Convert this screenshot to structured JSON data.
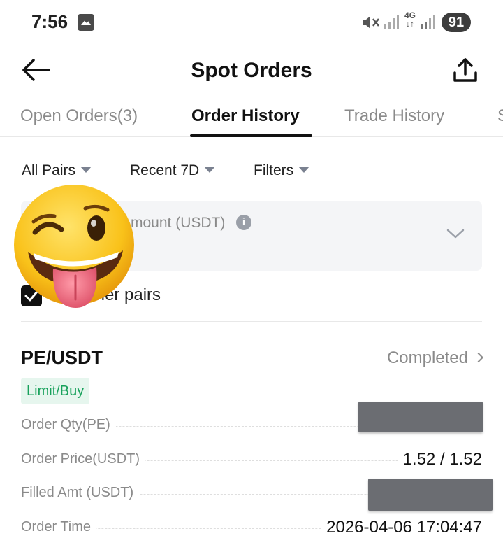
{
  "status_bar": {
    "time": "7:56",
    "network": "4G",
    "battery": "91",
    "icons": [
      "app-notification-icon",
      "mute-icon",
      "signal-icon",
      "signal-icon"
    ]
  },
  "header": {
    "title": "Spot Orders",
    "back_icon": "back-arrow-icon",
    "share_icon": "share-icon"
  },
  "tabs": [
    {
      "label": "Open Orders(3)",
      "active": false
    },
    {
      "label": "Order History",
      "active": true
    },
    {
      "label": "Trade History",
      "active": false
    },
    {
      "label": "S",
      "active": false
    }
  ],
  "filters": [
    {
      "label": "All Pairs"
    },
    {
      "label": "Recent 7D"
    },
    {
      "label": "Filters"
    }
  ],
  "amount_filter": {
    "label": "mount (USDT)",
    "info_icon": "i"
  },
  "hide_other_pairs": {
    "label": "ther pairs",
    "checked": true
  },
  "order": {
    "pair": "PE/USDT",
    "status": "Completed",
    "side_badge": "Limit/Buy",
    "rows": [
      {
        "label": "Order Qty(PE)",
        "value": ""
      },
      {
        "label": "Order Price(USDT)",
        "value": "1.52 / 1.52"
      },
      {
        "label": "Filled Amt (USDT)",
        "value": ""
      },
      {
        "label": "Order Time",
        "value": "2026-04-06 17:04:47"
      }
    ]
  },
  "colors": {
    "accent": "#111111",
    "badge_bg": "#e6f6ee",
    "badge_text": "#17a15b",
    "muted_text": "#8a8a8a",
    "redaction": "#6b6d72"
  }
}
